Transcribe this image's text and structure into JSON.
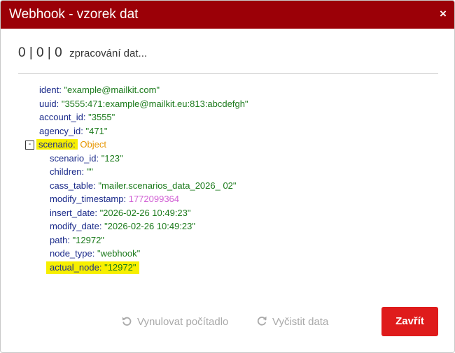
{
  "dialog": {
    "title": "Webhook - vzorek dat",
    "close_icon": "×"
  },
  "counter": {
    "values": "0 | 0 | 0",
    "status": "zpracování dat..."
  },
  "tree": {
    "ident_key": "ident:",
    "ident_val": "\"example@mailkit.com\"",
    "uuid_key": "uuid:",
    "uuid_val": "\"3555:471:example@mailkit.eu:813:abcdefgh\"",
    "account_id_key": "account_id:",
    "account_id_val": "\"3555\"",
    "agency_id_key": "agency_id:",
    "agency_id_val": "\"471\"",
    "toggle_label": "-",
    "scenario_key": "scenario:",
    "scenario_val": "Object",
    "scenario_id_key": "scenario_id:",
    "scenario_id_val": "\"123\"",
    "children_key": "children:",
    "children_val": "\"\"",
    "cass_table_key": "cass_table:",
    "cass_table_val": "\"mailer.scenarios_data_2026_ 02\"",
    "modify_timestamp_key": "modify_timestamp:",
    "modify_timestamp_val": "1772099364",
    "insert_date_key": "insert_date:",
    "insert_date_val": "\"2026-02-26 10:49:23\"",
    "modify_date_key": "modify_date:",
    "modify_date_val": "\"2026-02-26 10:49:23\"",
    "path_key": "path:",
    "path_val": "\"12972\"",
    "node_type_key": "node_type:",
    "node_type_val": "\"webhook\"",
    "actual_node_key": "actual_node:",
    "actual_node_val": "\"12972\""
  },
  "footer": {
    "reset_label": "Vynulovat počítadlo",
    "reset_icon": "undo-icon",
    "clear_label": "Vyčistit data",
    "clear_icon": "refresh-icon",
    "close_label": "Zavřít"
  },
  "colors": {
    "titlebar": "#9b0007",
    "close_button": "#df1b1b",
    "key": "#1a2a8a",
    "string_value": "#1b7a1b",
    "number_value": "#d15fd4",
    "object_value": "#e69500",
    "highlight": "#f7ef00"
  }
}
